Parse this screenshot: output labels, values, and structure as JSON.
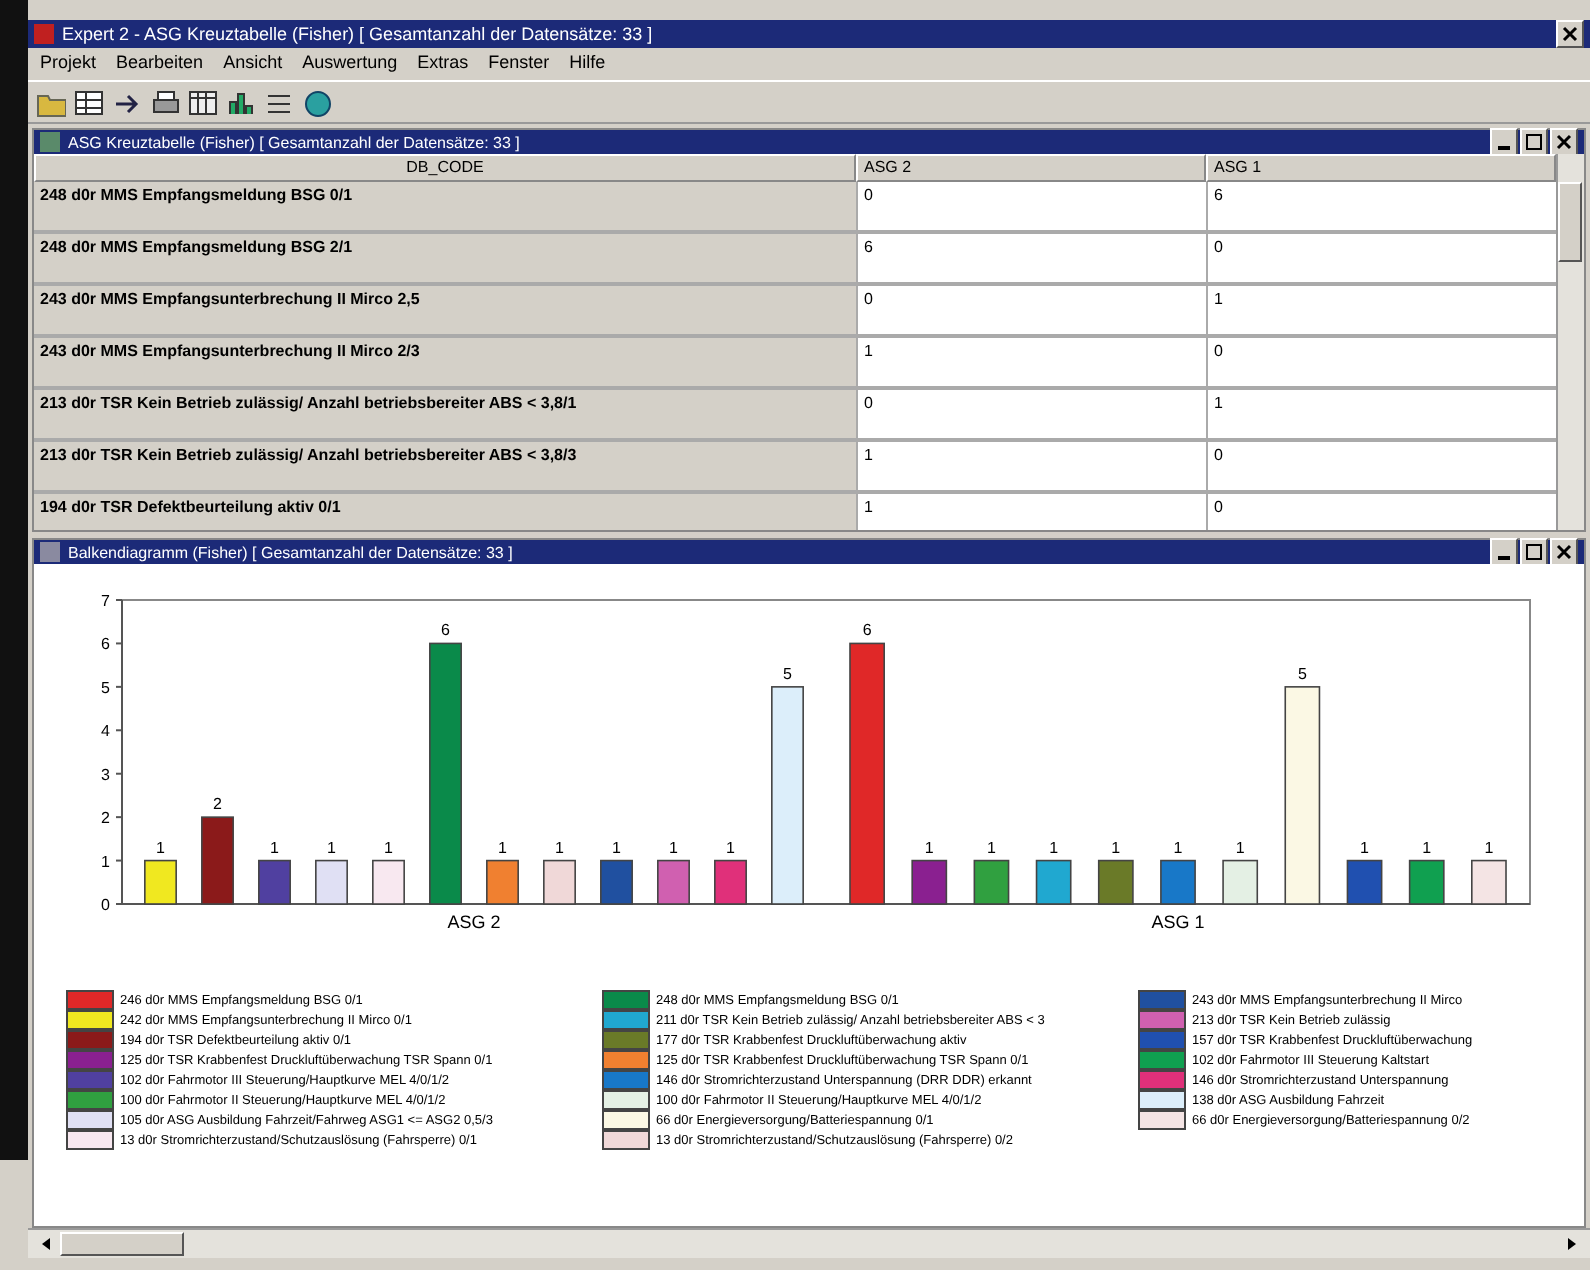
{
  "window": {
    "title": "Expert 2 - ASG Kreuztabelle (Fisher) [ Gesamtanzahl der Datensätze: 33 ]"
  },
  "menu": [
    "Projekt",
    "Bearbeiten",
    "Ansicht",
    "Auswertung",
    "Extras",
    "Fenster",
    "Hilfe"
  ],
  "table_window": {
    "title": "ASG Kreuztabelle (Fisher) [ Gesamtanzahl der Datensätze: 33 ]",
    "columns": [
      "DB_CODE",
      "ASG 2",
      "ASG 1"
    ],
    "rows": [
      [
        "248 d0r MMS Empfangsmeldung BSG 0/1",
        "0",
        "6"
      ],
      [
        "248 d0r MMS Empfangsmeldung BSG 2/1",
        "6",
        "0"
      ],
      [
        "243 d0r MMS Empfangsunterbrechung II Mirco 2,5",
        "0",
        "1"
      ],
      [
        "243 d0r MMS Empfangsunterbrechung II Mirco 2/3",
        "1",
        "0"
      ],
      [
        "213 d0r TSR Kein Betrieb zulässig/ Anzahl betriebsbereiter ABS < 3,8/1",
        "0",
        "1"
      ],
      [
        "213 d0r TSR Kein Betrieb zulässig/ Anzahl betriebsbereiter ABS < 3,8/3",
        "1",
        "0"
      ],
      [
        "194 d0r TSR Defektbeurteilung aktiv 0/1",
        "1",
        "0"
      ]
    ]
  },
  "chart_window": {
    "title": "Balkendiagramm (Fisher) [ Gesamtanzahl der Datensätze: 33 ]",
    "chart_data": {
      "type": "bar",
      "categories": [
        "ASG 2",
        "ASG 1"
      ],
      "ylim": [
        0,
        7
      ],
      "yticks": [
        0,
        1,
        2,
        3,
        4,
        5,
        6,
        7
      ],
      "data_labels": true,
      "series": [
        {
          "name": "246 d0r MMS Empfangsmeldung BSG 0/1",
          "color": "#e02828",
          "values": [
            null,
            6
          ]
        },
        {
          "name": "242 d0r MMS Empfangsunterbrechung II Mirco 0/1",
          "color": "#f0e820",
          "values": [
            1,
            null
          ]
        },
        {
          "name": "194 d0r TSR Defektbeurteilung aktiv 0/1",
          "color": "#8b1a1a",
          "values": [
            2,
            null
          ]
        },
        {
          "name": "125 d0r TSR Krabbenfest Druckluftüberwachung TSR Spann 0/1",
          "color": "#8a2090",
          "values": [
            null,
            1
          ]
        },
        {
          "name": "102 d0r Fahrmotor III Steuerung/Hauptkurve MEL 4/0/1/2",
          "color": "#5040a0",
          "values": [
            1,
            null
          ]
        },
        {
          "name": "100 d0r Fahrmotor II Steuerung/Hauptkurve MEL 4/0/1/2",
          "color": "#30a040",
          "values": [
            null,
            1
          ]
        },
        {
          "name": "105 d0r ASG Ausbildung Fahrzeit/Fahrweg ASG1 <= ASG2 0,5/3",
          "color": "#e0e0f4",
          "values": [
            1,
            null
          ]
        },
        {
          "name": "13 d0r Stromrichterzustand/Schutzauslösung (Fahrsperre) 0/1",
          "color": "#f8e8f0",
          "values": [
            1,
            null
          ]
        },
        {
          "name": "248 d0r MMS Empfangsmeldung BSG 0/1",
          "color": "#0a8a4a",
          "values": [
            6,
            null
          ]
        },
        {
          "name": "211 d0r TSR Kein Betrieb zulässig/ Anzahl betriebsbereiter ABS < 3",
          "color": "#20a8d0",
          "values": [
            null,
            1
          ]
        },
        {
          "name": "177 d0r TSR Krabbenfest Druckluftüberwachung aktiv",
          "color": "#6a7a28",
          "values": [
            null,
            1
          ]
        },
        {
          "name": "125 d0r TSR Krabbenfest Druckluftüberwachung TSR Spann 0/1",
          "color": "#f08030",
          "values": [
            1,
            null
          ]
        },
        {
          "name": "146 d0r Stromrichterzustand Unterspannung (DRR DDR) erkannt",
          "color": "#1878c8",
          "values": [
            null,
            1
          ]
        },
        {
          "name": "100 d0r Fahrmotor II Steuerung/Hauptkurve MEL 4/0/1/2",
          "color": "#e4f0e4",
          "values": [
            null,
            1
          ]
        },
        {
          "name": "66 d0r Energieversorgung/Batteriespannung 0/1",
          "color": "#fbf8e4",
          "values": [
            null,
            5
          ]
        },
        {
          "name": "13 d0r Stromrichterzustand/Schutzauslösung (Fahrsperre) 0/2",
          "color": "#f0d8d8",
          "values": [
            1,
            null
          ]
        },
        {
          "name": "243 d0r MMS Empfangsunterbrechung II Mirco",
          "color": "#2050a0",
          "values": [
            1,
            null
          ]
        },
        {
          "name": "213 d0r TSR Kein Betrieb zulässig",
          "color": "#d060b0",
          "values": [
            1,
            null
          ]
        },
        {
          "name": "157 d0r TSR Krabbenfest Druckluftüberwachung",
          "color": "#2050b0",
          "values": [
            null,
            1
          ]
        },
        {
          "name": "102 d0r Fahrmotor III Steuerung Kaltstart",
          "color": "#10a050",
          "values": [
            null,
            1
          ]
        },
        {
          "name": "146 d0r Stromrichterzustand Unterspannung",
          "color": "#e0307a",
          "values": [
            1,
            null
          ]
        },
        {
          "name": "138 d0r ASG Ausbildung Fahrzeit",
          "color": "#dceefa",
          "values": [
            5,
            null
          ]
        },
        {
          "name": "66 d0r Energieversorgung/Batteriespannung 0/2",
          "color": "#f4e4e4",
          "values": [
            null,
            1
          ]
        }
      ]
    }
  }
}
